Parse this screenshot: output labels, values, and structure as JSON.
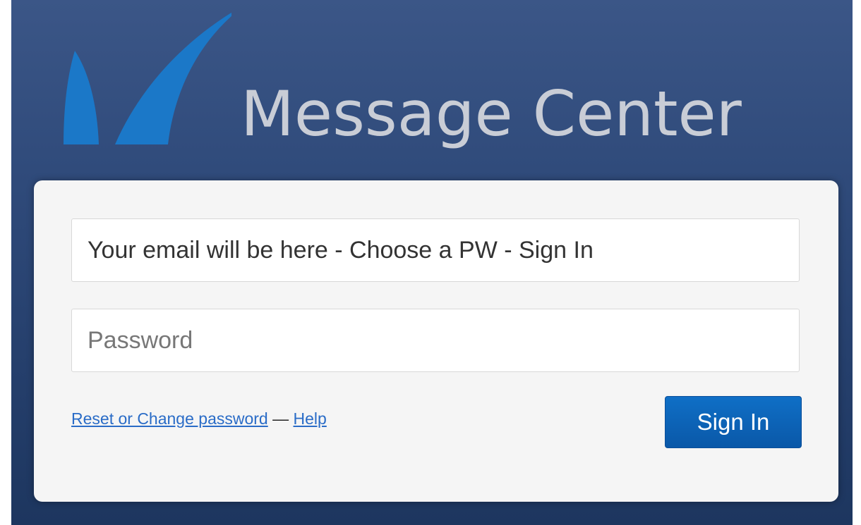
{
  "app": {
    "title": "Message Center",
    "logo_icon": "shark-fin-logo-icon",
    "logo_color": "#1b78c8"
  },
  "form": {
    "email_value": "Your email will be here - Choose a PW - Sign In",
    "password_placeholder": "Password",
    "reset_link": "Reset or Change password",
    "separator": " — ",
    "help_link": "Help",
    "sign_in_label": "Sign In"
  },
  "colors": {
    "background": "#2f4a7a",
    "card": "#f5f5f5",
    "button": "#0a5fb4",
    "link": "#2a6cc7"
  }
}
